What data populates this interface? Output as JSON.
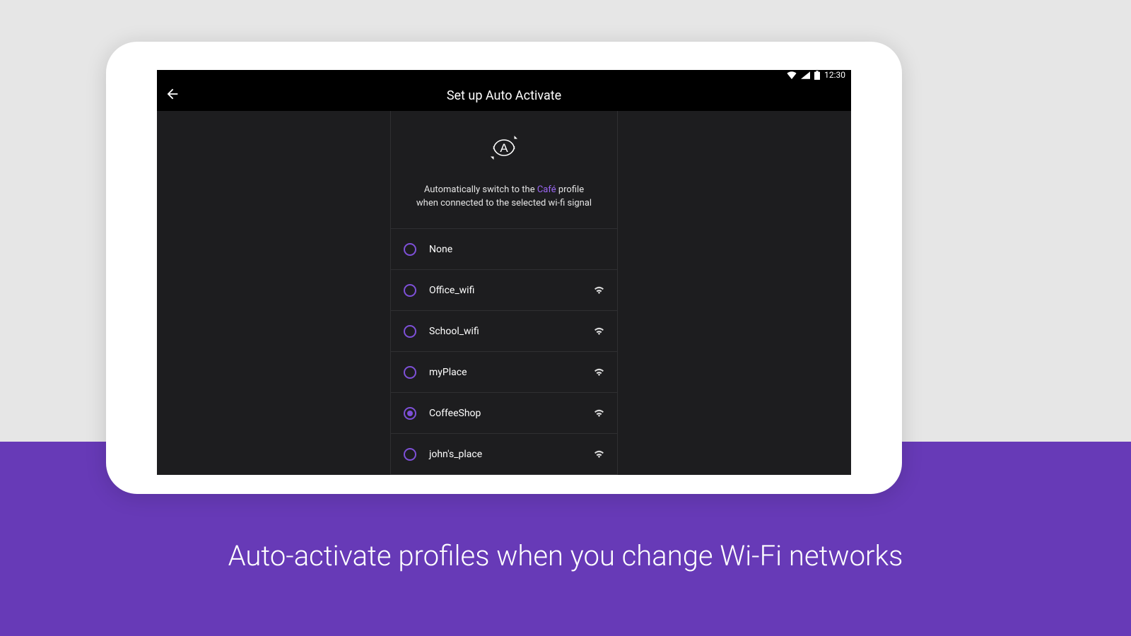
{
  "statusbar": {
    "time": "12:30"
  },
  "appbar": {
    "title": "Set up Auto Activate"
  },
  "intro": {
    "line1_pre": "Automatically switch to the ",
    "line1_hl": "Café",
    "line1_post": " profile",
    "line2": "when connected to the selected wi-fi signal"
  },
  "networks": [
    {
      "label": "None",
      "hasSignal": false,
      "selected": false
    },
    {
      "label": "Office_wifi",
      "hasSignal": true,
      "selected": false
    },
    {
      "label": "School_wifi",
      "hasSignal": true,
      "selected": false
    },
    {
      "label": "myPlace",
      "hasSignal": true,
      "selected": false
    },
    {
      "label": "CoffeeShop",
      "hasSignal": true,
      "selected": true
    },
    {
      "label": "john's_place",
      "hasSignal": true,
      "selected": false
    }
  ],
  "caption": "Auto-activate profiles when you change Wi-Fi networks"
}
